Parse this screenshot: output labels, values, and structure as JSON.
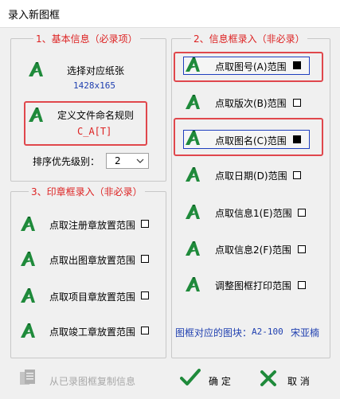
{
  "window": {
    "title": "录入新图框"
  },
  "group_basic": {
    "legend": "1、基本信息（必录项）",
    "select_paper": {
      "label": "选择对应纸张",
      "value": "1428x165"
    },
    "naming_rule": {
      "label": "定义文件命名规则",
      "value": "C_A[T]"
    },
    "priority": {
      "label": "排序优先级别：",
      "value": "2"
    }
  },
  "group_stamp": {
    "legend": "3、印章框录入（非必录）",
    "items": [
      {
        "label": "点取注册章放置范围"
      },
      {
        "label": "点取出图章放置范围"
      },
      {
        "label": "点取项目章放置范围"
      },
      {
        "label": "点取竣工章放置范围"
      }
    ]
  },
  "group_info": {
    "legend": "2、信息框录入（非必录）",
    "items": [
      {
        "label": "点取图号(A)范围",
        "checked": true
      },
      {
        "label": "点取版次(B)范围",
        "checked": false
      },
      {
        "label": "点取图名(C)范围",
        "checked": true
      },
      {
        "label": "点取日期(D)范围",
        "checked": false
      },
      {
        "label": "点取信息1(E)范围",
        "checked": false
      },
      {
        "label": "点取信息2(F)范围",
        "checked": false
      },
      {
        "label": "调整图框打印范围",
        "checked": false
      }
    ],
    "block_label": "图框对应的图块：",
    "block_name": "A2-100",
    "block_font": "宋亚楠"
  },
  "footer": {
    "copy_label": "从已录图框复制信息",
    "ok_label": "确 定",
    "cancel_label": "取 消"
  },
  "colors": {
    "accent_red": "#d22222",
    "icon_green": "#1f8a3b",
    "focus_blue": "#1f3fbf",
    "highlight": "#e0474c"
  }
}
